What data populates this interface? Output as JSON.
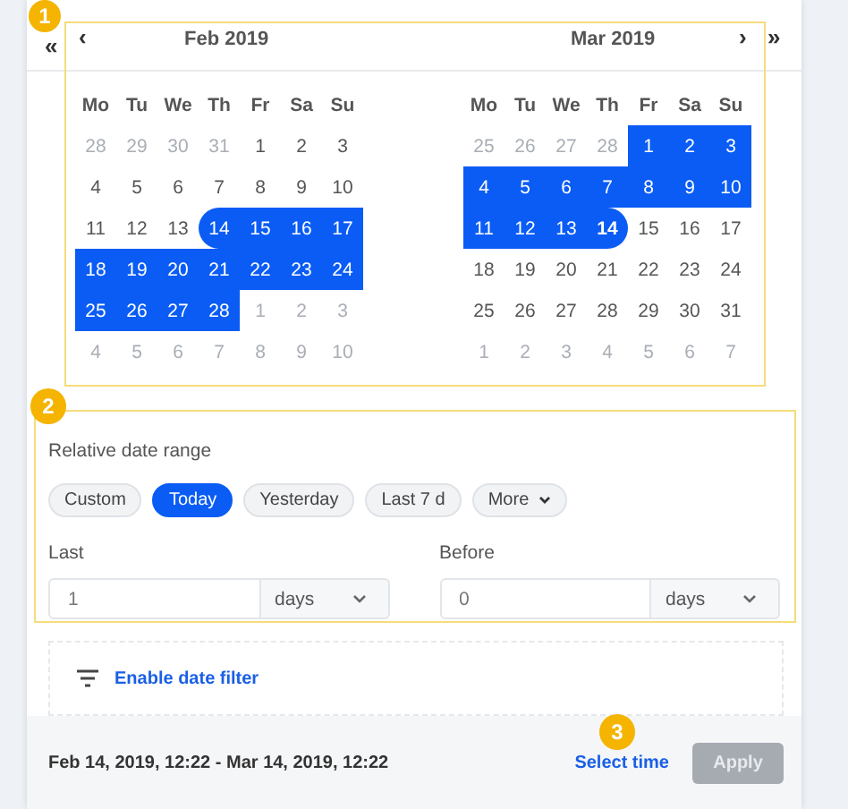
{
  "nav": {
    "prev_year": "«",
    "prev_month": "‹",
    "next_month": "›",
    "next_year": "»"
  },
  "months": [
    {
      "title": "Feb 2019",
      "weekdays": [
        "Mo",
        "Tu",
        "We",
        "Th",
        "Fr",
        "Sa",
        "Su"
      ],
      "days": [
        {
          "d": "28",
          "muted": true,
          "selected": false
        },
        {
          "d": "29",
          "muted": true,
          "selected": false
        },
        {
          "d": "30",
          "muted": true,
          "selected": false
        },
        {
          "d": "31",
          "muted": true,
          "selected": false
        },
        {
          "d": "1",
          "muted": false,
          "selected": false
        },
        {
          "d": "2",
          "muted": false,
          "selected": false
        },
        {
          "d": "3",
          "muted": false,
          "selected": false
        },
        {
          "d": "4",
          "muted": false,
          "selected": false
        },
        {
          "d": "5",
          "muted": false,
          "selected": false
        },
        {
          "d": "6",
          "muted": false,
          "selected": false
        },
        {
          "d": "7",
          "muted": false,
          "selected": false
        },
        {
          "d": "8",
          "muted": false,
          "selected": false
        },
        {
          "d": "9",
          "muted": false,
          "selected": false
        },
        {
          "d": "10",
          "muted": false,
          "selected": false
        },
        {
          "d": "11",
          "muted": false,
          "selected": false
        },
        {
          "d": "12",
          "muted": false,
          "selected": false
        },
        {
          "d": "13",
          "muted": false,
          "selected": false
        },
        {
          "d": "14",
          "muted": false,
          "selected": true
        },
        {
          "d": "15",
          "muted": false,
          "selected": true
        },
        {
          "d": "16",
          "muted": false,
          "selected": true
        },
        {
          "d": "17",
          "muted": false,
          "selected": true
        },
        {
          "d": "18",
          "muted": false,
          "selected": true
        },
        {
          "d": "19",
          "muted": false,
          "selected": true
        },
        {
          "d": "20",
          "muted": false,
          "selected": true
        },
        {
          "d": "21",
          "muted": false,
          "selected": true
        },
        {
          "d": "22",
          "muted": false,
          "selected": true
        },
        {
          "d": "23",
          "muted": false,
          "selected": true
        },
        {
          "d": "24",
          "muted": false,
          "selected": true
        },
        {
          "d": "25",
          "muted": false,
          "selected": true
        },
        {
          "d": "26",
          "muted": false,
          "selected": true
        },
        {
          "d": "27",
          "muted": false,
          "selected": true
        },
        {
          "d": "28",
          "muted": false,
          "selected": true
        },
        {
          "d": "1",
          "muted": true,
          "selected": false
        },
        {
          "d": "2",
          "muted": true,
          "selected": false
        },
        {
          "d": "3",
          "muted": true,
          "selected": false
        },
        {
          "d": "4",
          "muted": true,
          "selected": false
        },
        {
          "d": "5",
          "muted": true,
          "selected": false
        },
        {
          "d": "6",
          "muted": true,
          "selected": false
        },
        {
          "d": "7",
          "muted": true,
          "selected": false
        },
        {
          "d": "8",
          "muted": true,
          "selected": false
        },
        {
          "d": "9",
          "muted": true,
          "selected": false
        },
        {
          "d": "10",
          "muted": true,
          "selected": false
        }
      ]
    },
    {
      "title": "Mar 2019",
      "weekdays": [
        "Mo",
        "Tu",
        "We",
        "Th",
        "Fr",
        "Sa",
        "Su"
      ],
      "days": [
        {
          "d": "25",
          "muted": true,
          "selected": false
        },
        {
          "d": "26",
          "muted": true,
          "selected": false
        },
        {
          "d": "27",
          "muted": true,
          "selected": false
        },
        {
          "d": "28",
          "muted": true,
          "selected": false
        },
        {
          "d": "1",
          "muted": false,
          "selected": true
        },
        {
          "d": "2",
          "muted": false,
          "selected": true
        },
        {
          "d": "3",
          "muted": false,
          "selected": true
        },
        {
          "d": "4",
          "muted": false,
          "selected": true
        },
        {
          "d": "5",
          "muted": false,
          "selected": true
        },
        {
          "d": "6",
          "muted": false,
          "selected": true
        },
        {
          "d": "7",
          "muted": false,
          "selected": true
        },
        {
          "d": "8",
          "muted": false,
          "selected": true
        },
        {
          "d": "9",
          "muted": false,
          "selected": true
        },
        {
          "d": "10",
          "muted": false,
          "selected": true
        },
        {
          "d": "11",
          "muted": false,
          "selected": true
        },
        {
          "d": "12",
          "muted": false,
          "selected": true
        },
        {
          "d": "13",
          "muted": false,
          "selected": true
        },
        {
          "d": "14",
          "muted": false,
          "selected": true,
          "today": true
        },
        {
          "d": "15",
          "muted": false,
          "selected": false
        },
        {
          "d": "16",
          "muted": false,
          "selected": false
        },
        {
          "d": "17",
          "muted": false,
          "selected": false
        },
        {
          "d": "18",
          "muted": false,
          "selected": false
        },
        {
          "d": "19",
          "muted": false,
          "selected": false
        },
        {
          "d": "20",
          "muted": false,
          "selected": false
        },
        {
          "d": "21",
          "muted": false,
          "selected": false
        },
        {
          "d": "22",
          "muted": false,
          "selected": false
        },
        {
          "d": "23",
          "muted": false,
          "selected": false
        },
        {
          "d": "24",
          "muted": false,
          "selected": false
        },
        {
          "d": "25",
          "muted": false,
          "selected": false
        },
        {
          "d": "26",
          "muted": false,
          "selected": false
        },
        {
          "d": "27",
          "muted": false,
          "selected": false
        },
        {
          "d": "28",
          "muted": false,
          "selected": false
        },
        {
          "d": "29",
          "muted": false,
          "selected": false
        },
        {
          "d": "30",
          "muted": false,
          "selected": false
        },
        {
          "d": "31",
          "muted": false,
          "selected": false
        },
        {
          "d": "1",
          "muted": true,
          "selected": false
        },
        {
          "d": "2",
          "muted": true,
          "selected": false
        },
        {
          "d": "3",
          "muted": true,
          "selected": false
        },
        {
          "d": "4",
          "muted": true,
          "selected": false
        },
        {
          "d": "5",
          "muted": true,
          "selected": false
        },
        {
          "d": "6",
          "muted": true,
          "selected": false
        },
        {
          "d": "7",
          "muted": true,
          "selected": false
        }
      ]
    }
  ],
  "relative": {
    "label": "Relative date range",
    "presets": [
      {
        "label": "Custom",
        "selected": false,
        "kind": "chip"
      },
      {
        "label": "Today",
        "selected": true,
        "kind": "chip"
      },
      {
        "label": "Yesterday",
        "selected": false,
        "kind": "chip"
      },
      {
        "label": "Last 7 d",
        "selected": false,
        "kind": "chip"
      },
      {
        "label": "More",
        "selected": false,
        "kind": "dropdown"
      }
    ],
    "fields": [
      {
        "label": "Last",
        "value": "1",
        "unit": "days"
      },
      {
        "label": "Before",
        "value": "0",
        "unit": "days"
      }
    ]
  },
  "filter": {
    "label": "Enable date filter"
  },
  "footer": {
    "range": "Feb 14, 2019, 12:22 - Mar 14, 2019, 12:22",
    "select_time": "Select time",
    "apply": {
      "label": "Apply",
      "disabled": true
    }
  },
  "annotations": [
    "1",
    "2",
    "3"
  ]
}
